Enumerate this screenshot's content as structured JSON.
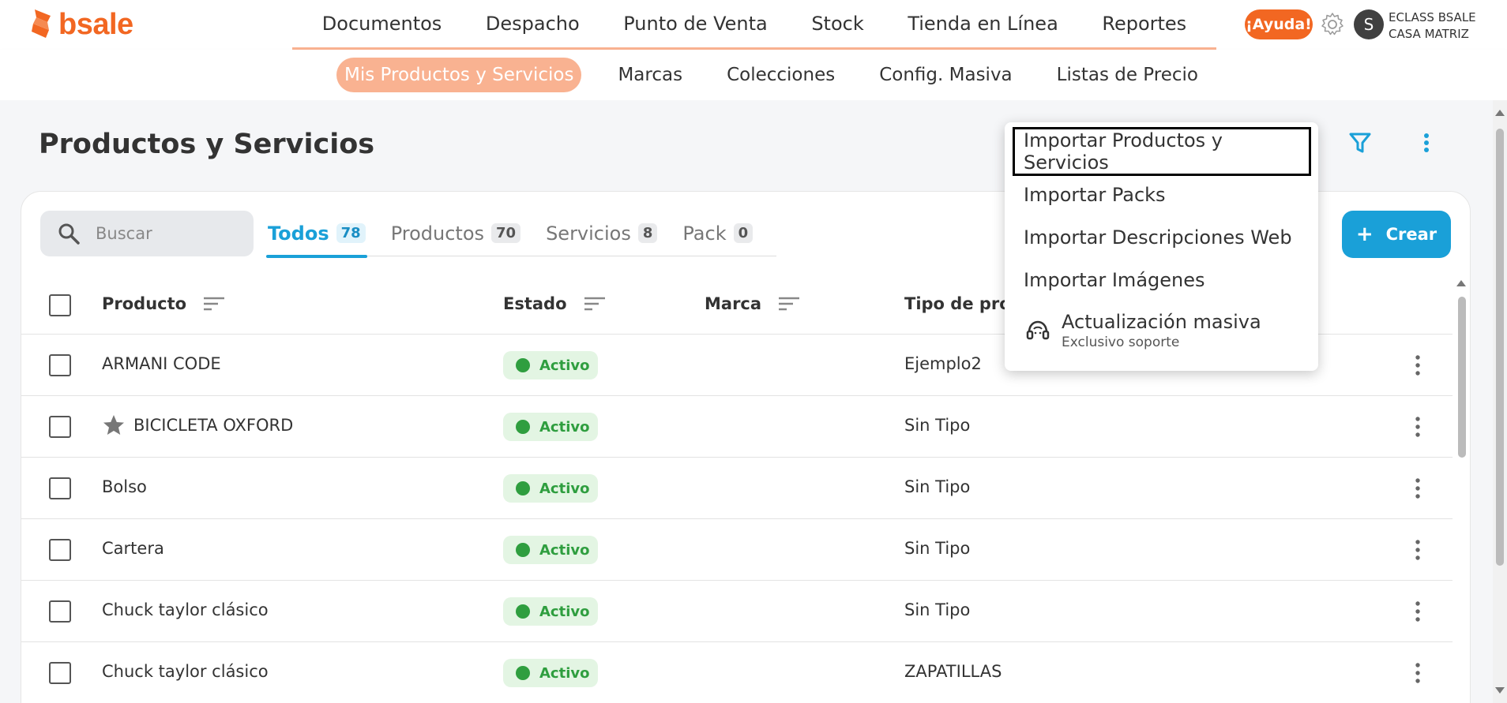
{
  "brand": {
    "name": "bsale",
    "color": "#f26722"
  },
  "main_nav": [
    "Documentos",
    "Despacho",
    "Punto de Venta",
    "Stock",
    "Tienda en Línea",
    "Reportes"
  ],
  "header": {
    "help_label": "¡Ayuda!",
    "avatar_initial": "S",
    "company": "ECLASS BSALE",
    "branch": "CASA MATRIZ"
  },
  "sub_nav": {
    "active": "Mis Productos y Servicios",
    "items": [
      "Marcas",
      "Colecciones",
      "Config. Masiva",
      "Listas de Precio"
    ]
  },
  "page": {
    "title": "Productos y Servicios"
  },
  "search": {
    "placeholder": "Buscar"
  },
  "tabs": [
    {
      "label": "Todos",
      "count": "78"
    },
    {
      "label": "Productos",
      "count": "70"
    },
    {
      "label": "Servicios",
      "count": "8"
    },
    {
      "label": "Pack",
      "count": "0"
    }
  ],
  "create_label": "Crear",
  "table": {
    "columns": [
      "Producto",
      "Estado",
      "Marca",
      "Tipo de prod"
    ],
    "rows": [
      {
        "product": "ARMANI CODE",
        "status": "Activo",
        "brand": "",
        "type": "Ejemplo2",
        "starred": false
      },
      {
        "product": "BICICLETA OXFORD",
        "status": "Activo",
        "brand": "",
        "type": "Sin Tipo",
        "starred": true
      },
      {
        "product": "Bolso",
        "status": "Activo",
        "brand": "",
        "type": "Sin Tipo",
        "starred": false
      },
      {
        "product": "Cartera",
        "status": "Activo",
        "brand": "",
        "type": "Sin Tipo",
        "starred": false
      },
      {
        "product": "Chuck taylor clásico",
        "status": "Activo",
        "brand": "",
        "type": "Sin Tipo",
        "starred": false
      },
      {
        "product": "Chuck taylor clásico",
        "status": "Activo",
        "brand": "",
        "type": "ZAPATILLAS",
        "starred": false
      }
    ]
  },
  "menu": {
    "items": [
      "Importar Productos y Servicios",
      "Importar Packs",
      "Importar Descripciones Web",
      "Importar Imágenes"
    ],
    "support_title": "Actualización masiva",
    "support_subtitle": "Exclusivo soporte"
  },
  "colors": {
    "accent": "#1aa0d8",
    "active_green": "#2f9e3f",
    "subnav_active": "#f9b291"
  }
}
